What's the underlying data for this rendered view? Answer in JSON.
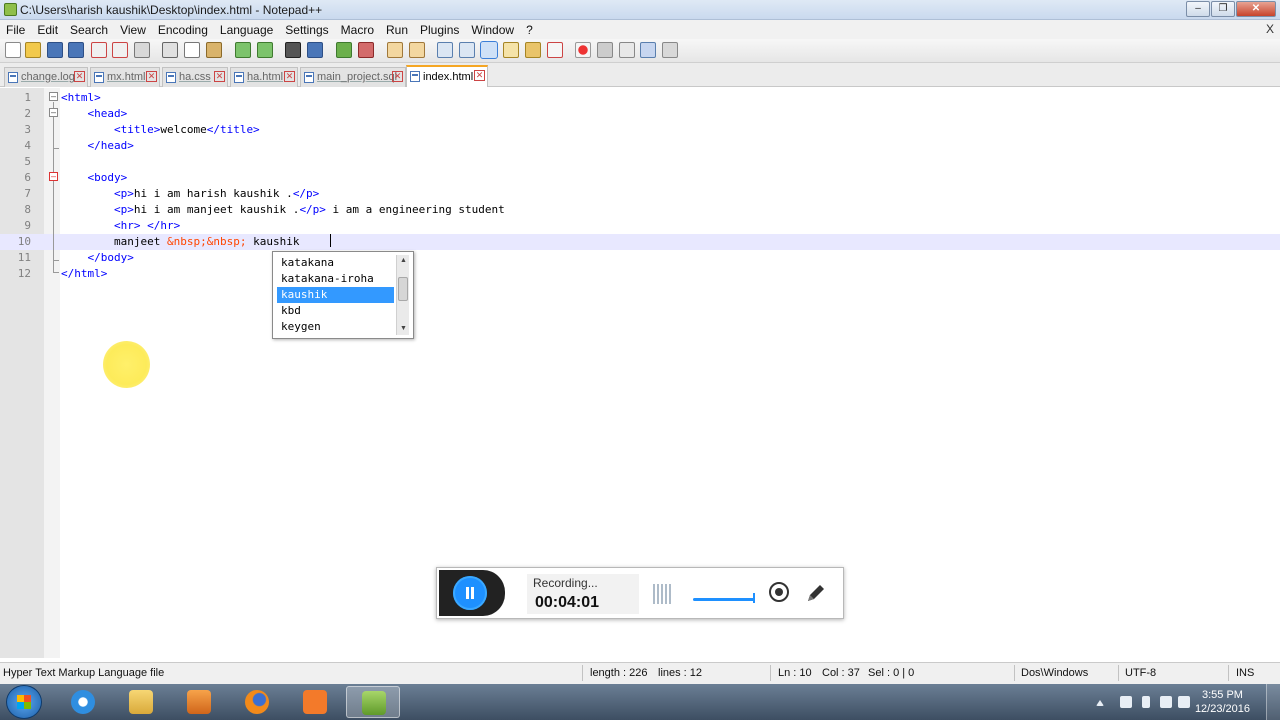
{
  "window": {
    "title": "C:\\Users\\harish kaushik\\Desktop\\index.html - Notepad++"
  },
  "menu": {
    "items": [
      "File",
      "Edit",
      "Search",
      "View",
      "Encoding",
      "Language",
      "Settings",
      "Macro",
      "Run",
      "Plugins",
      "Window",
      "?"
    ],
    "close_doc": "X"
  },
  "tabs": [
    {
      "label": "change.log",
      "active": false
    },
    {
      "label": "mx.html",
      "active": false
    },
    {
      "label": "ha.css",
      "active": false
    },
    {
      "label": "ha.html",
      "active": false
    },
    {
      "label": "main_project.sql",
      "active": false
    },
    {
      "label": "index.html",
      "active": true
    }
  ],
  "editor": {
    "line_numbers": [
      "1",
      "2",
      "3",
      "4",
      "5",
      "6",
      "7",
      "8",
      "9",
      "10",
      "11",
      "12"
    ],
    "current_line": 10,
    "lines": [
      "<html>",
      "    <head>",
      "        <title>welcome</title>",
      "    </head>",
      "",
      "    <body>",
      "        <p>hi i am harish kaushik .</p>",
      "        <p>hi i am manjeet kaushik .</p> i am a engineering student",
      "        <hr> </hr>",
      "        manjeet &nbsp;&nbsp; kaushik",
      "    </body>",
      "</html>"
    ]
  },
  "autocomplete": {
    "items": [
      "katakana",
      "katakana-iroha",
      "kaushik",
      "kbd",
      "keygen"
    ],
    "selected": "kaushik"
  },
  "recorder": {
    "status": "Recording...",
    "elapsed": "00:04:01"
  },
  "statusbar": {
    "file_type": "Hyper Text Markup Language file",
    "length": "length : 226",
    "lines": "lines : 12",
    "ln": "Ln : 10",
    "col": "Col : 37",
    "sel": "Sel : 0 | 0",
    "eol": "Dos\\Windows",
    "encoding": "UTF-8",
    "mode": "INS"
  },
  "taskbar": {
    "time": "3:55 PM",
    "date": "12/23/2016"
  },
  "colors": {
    "tag": "#0000ff",
    "entity": "#ff4500",
    "current_line": "#e8e8ff",
    "selection": "#3399ff",
    "accent": "#1e90ff"
  }
}
